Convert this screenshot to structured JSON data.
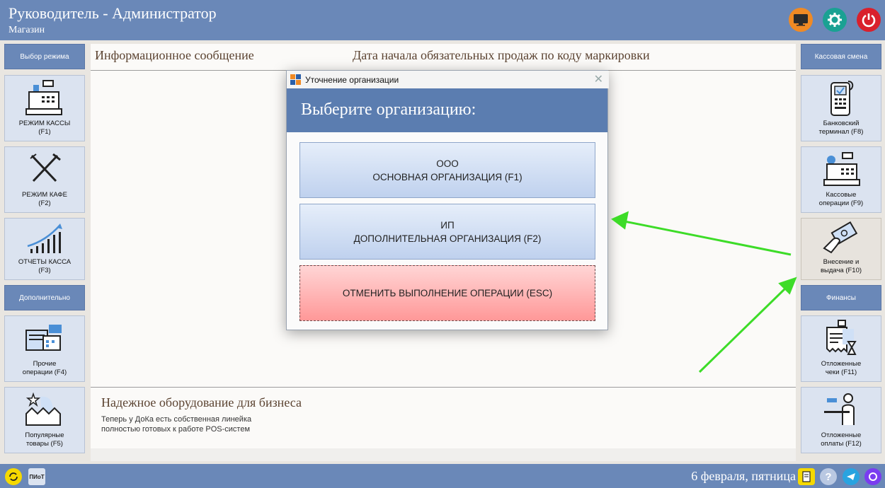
{
  "header": {
    "title": "Руководитель - Администратор",
    "subtitle": "Магазин"
  },
  "top_icons": [
    "monitor-icon",
    "gear-icon",
    "power-icon"
  ],
  "left_panel": {
    "section1": "Выбор режима",
    "tiles1": [
      {
        "label": "РЕЖИМ КАССЫ\n(F1)",
        "icon": "cash-register-icon"
      },
      {
        "label": "РЕЖИМ КАФЕ\n(F2)",
        "icon": "fork-knife-icon"
      },
      {
        "label": "ОТЧЕТЫ КАССА\n(F3)",
        "icon": "chart-icon"
      }
    ],
    "section2": "Дополнительно",
    "tiles2": [
      {
        "label": "Прочие\nоперации (F4)",
        "icon": "documents-icon"
      },
      {
        "label": "Популярные\nтовары (F5)",
        "icon": "popular-goods-icon"
      }
    ]
  },
  "right_panel": {
    "section1": "Кассовая смена",
    "tiles1": [
      {
        "label": "Банковский\nтерминал (F8)",
        "icon": "bank-terminal-icon"
      },
      {
        "label": "Кассовые\nоперации (F9)",
        "icon": "cashier-icon"
      },
      {
        "label": "Внесение и\nвыдача (F10)",
        "icon": "money-hand-icon"
      }
    ],
    "section2": "Финансы",
    "tiles2": [
      {
        "label": "Отложенные\nчеки (F11)",
        "icon": "receipt-hourglass-icon"
      },
      {
        "label": "Отложенные\nоплаты (F12)",
        "icon": "person-payment-icon"
      }
    ]
  },
  "center": {
    "info_header": "Информационное сообщение",
    "date_header": "Дата начала обязательных продаж по коду маркировки",
    "ad_title": "Надежное оборудование для бизнеса",
    "ad_text": "Теперь у ДоКа есть собственная линейка\nполностью готовых к работе POS-систем"
  },
  "dialog": {
    "window_title": "Уточнение организации",
    "heading": "Выберите организацию:",
    "options": [
      {
        "line1": "ООО",
        "line2": "ОСНОВНАЯ ОРГАНИЗАЦИЯ (F1)"
      },
      {
        "line1": "ИП",
        "line2": "ДОПОЛНИТЕЛЬНАЯ ОРГАНИЗАЦИЯ (F2)"
      }
    ],
    "cancel_label": "ОТМЕНИТЬ ВЫПОЛНЕНИЕ ОПЕРАЦИИ (ESC)"
  },
  "statusbar": {
    "badge": "ПИоТ",
    "date": "6 февраля, пятница"
  },
  "colors": {
    "bar": "#6a88b8",
    "annotation_arrow": "#3ddc28"
  }
}
